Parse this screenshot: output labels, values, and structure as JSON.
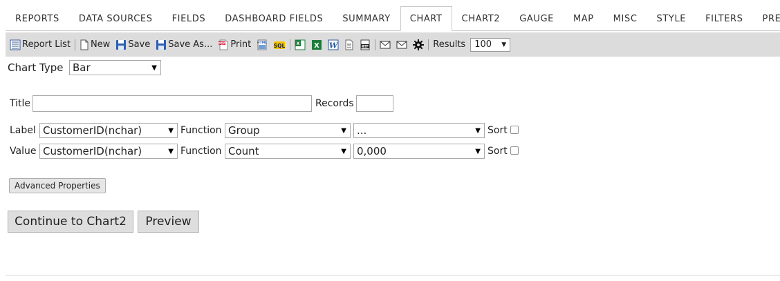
{
  "tabs": [
    {
      "label": "REPORTS"
    },
    {
      "label": "DATA SOURCES"
    },
    {
      "label": "FIELDS"
    },
    {
      "label": "DASHBOARD FIELDS"
    },
    {
      "label": "SUMMARY"
    },
    {
      "label": "CHART",
      "active": true
    },
    {
      "label": "CHART2"
    },
    {
      "label": "GAUGE"
    },
    {
      "label": "MAP"
    },
    {
      "label": "MISC"
    },
    {
      "label": "STYLE"
    },
    {
      "label": "FILTERS"
    },
    {
      "label": "PREVIEW"
    }
  ],
  "toolbar": {
    "report_list": "Report List",
    "new": "New",
    "save": "Save",
    "save_as": "Save As...",
    "print": "Print",
    "results_label": "Results",
    "results_value": "100",
    "icons": {
      "report_list": "report-list-icon",
      "new": "new-document-icon",
      "save": "floppy-disk-icon",
      "save_as": "floppy-disk-icon",
      "print": "pdf-icon",
      "html": "html-export-icon",
      "sql": "sql-icon",
      "excel_alt": "excel-export-icon",
      "excel": "excel-icon",
      "word": "word-icon",
      "text": "text-file-icon",
      "rtf": "rtf-icon",
      "email": "email-icon",
      "email_alt": "email-icon",
      "settings": "gear-icon"
    }
  },
  "form": {
    "chart_type_label": "Chart Type",
    "chart_type_value": "Bar",
    "title_label": "Title",
    "title_value": "",
    "records_label": "Records",
    "records_value": "",
    "label_row": {
      "label": "Label",
      "field": "CustomerID(nchar)",
      "function_label": "Function",
      "function_value": "Group",
      "format_value": "...",
      "sort_label": "Sort"
    },
    "value_row": {
      "label": "Value",
      "field": "CustomerID(nchar)",
      "function_label": "Function",
      "function_value": "Count",
      "format_value": "0,000",
      "sort_label": "Sort"
    },
    "advanced_properties": "Advanced Properties",
    "continue_button": "Continue to Chart2",
    "preview_button": "Preview"
  },
  "colors": {
    "toolbar_bg": "#dcdcdc",
    "save_blue": "#2b5fb4",
    "excel_green": "#1e7b3a",
    "word_blue": "#2b5797"
  }
}
